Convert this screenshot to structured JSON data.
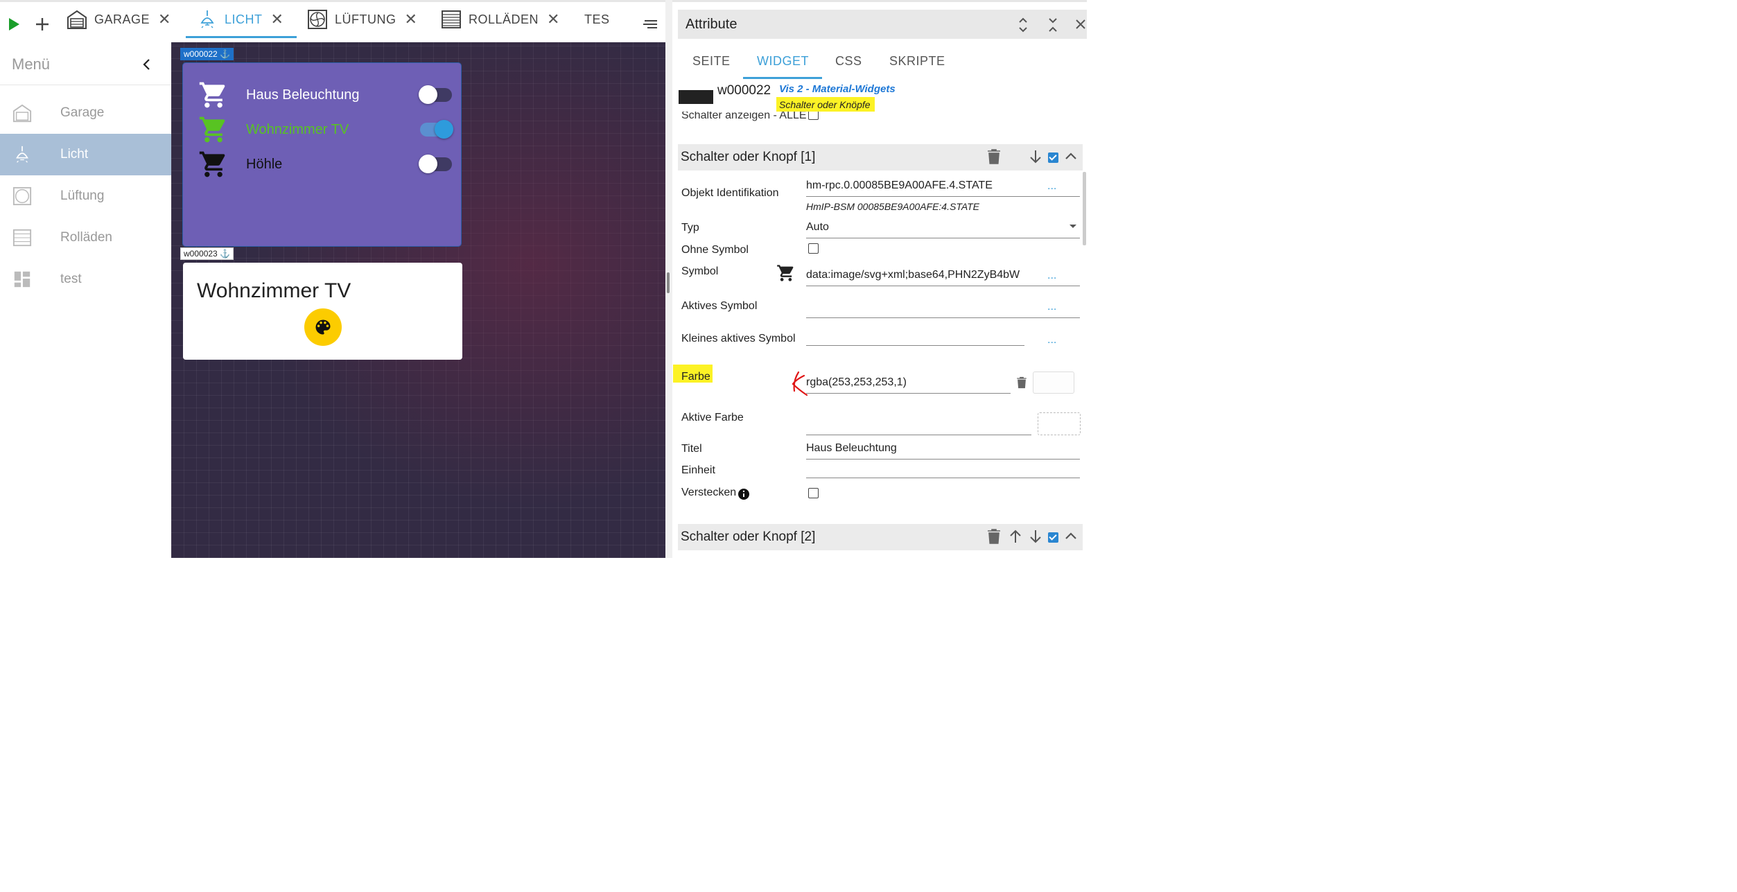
{
  "toolbar": {
    "tabs": [
      {
        "label": "GARAGE",
        "icon": "garage-icon"
      },
      {
        "label": "LICHT",
        "icon": "ceiling-lamp-icon",
        "active": true
      },
      {
        "label": "LÜFTUNG",
        "icon": "fan-icon"
      },
      {
        "label": "ROLLÄDEN",
        "icon": "shutter-icon"
      },
      {
        "label": "TES",
        "icon": ""
      }
    ],
    "close_glyph": "✕"
  },
  "sidebar": {
    "title": "Menü",
    "items": [
      {
        "label": "Garage",
        "icon": "garage-icon"
      },
      {
        "label": "Licht",
        "icon": "ceiling-lamp-icon",
        "active": true
      },
      {
        "label": "Lüftung",
        "icon": "fan-icon"
      },
      {
        "label": "Rolläden",
        "icon": "shutter-icon"
      },
      {
        "label": "test",
        "icon": "dashboard-icon"
      }
    ]
  },
  "canvas": {
    "widget1": {
      "id": "w000022",
      "rows": [
        {
          "title": "Haus Beleuchtung",
          "on": false,
          "color": "#ffffff"
        },
        {
          "title": "Wohnzimmer TV",
          "on": true,
          "color": "#58c322"
        },
        {
          "title": "Höhle",
          "on": false,
          "color": "#111111"
        }
      ]
    },
    "widget2": {
      "id": "w000023",
      "title": "Wohnzimmer TV",
      "button_color": "#fccc00"
    }
  },
  "panel": {
    "title": "Attribute",
    "tabs": [
      "SEITE",
      "WIDGET",
      "CSS",
      "SKRIPTE"
    ],
    "active_tab": "WIDGET",
    "widget_id": "w000022",
    "widget_set": "Vis 2 - Material-Widgets",
    "widget_type": "Schalter oder Knöpfe",
    "show_all_label": "Schalter anzeigen - ALLE",
    "section1": "Schalter oder Knopf [1]",
    "section2": "Schalter oder Knopf [2]",
    "fields": {
      "oid_label": "Objekt Identifikation",
      "oid_value": "hm-rpc.0.00085BE9A00AFE.4.STATE",
      "oid_desc": "HmIP-BSM 00085BE9A00AFE:4.STATE",
      "typ_label": "Typ",
      "typ_value": "Auto",
      "ohne_symbol_label": "Ohne Symbol",
      "symbol_label": "Symbol",
      "symbol_value": "data:image/svg+xml;base64,PHN2ZyB4bW",
      "aktives_symbol_label": "Aktives Symbol",
      "kleines_symbol_label": "Kleines aktives Symbol",
      "farbe_label": "Farbe",
      "farbe_value": "rgba(253,253,253,1)",
      "aktive_farbe_label": "Aktive Farbe",
      "titel_label": "Titel",
      "titel_value": "Haus Beleuchtung",
      "einheit_label": "Einheit",
      "verstecken_label": "Verstecken"
    },
    "dots": "..."
  }
}
